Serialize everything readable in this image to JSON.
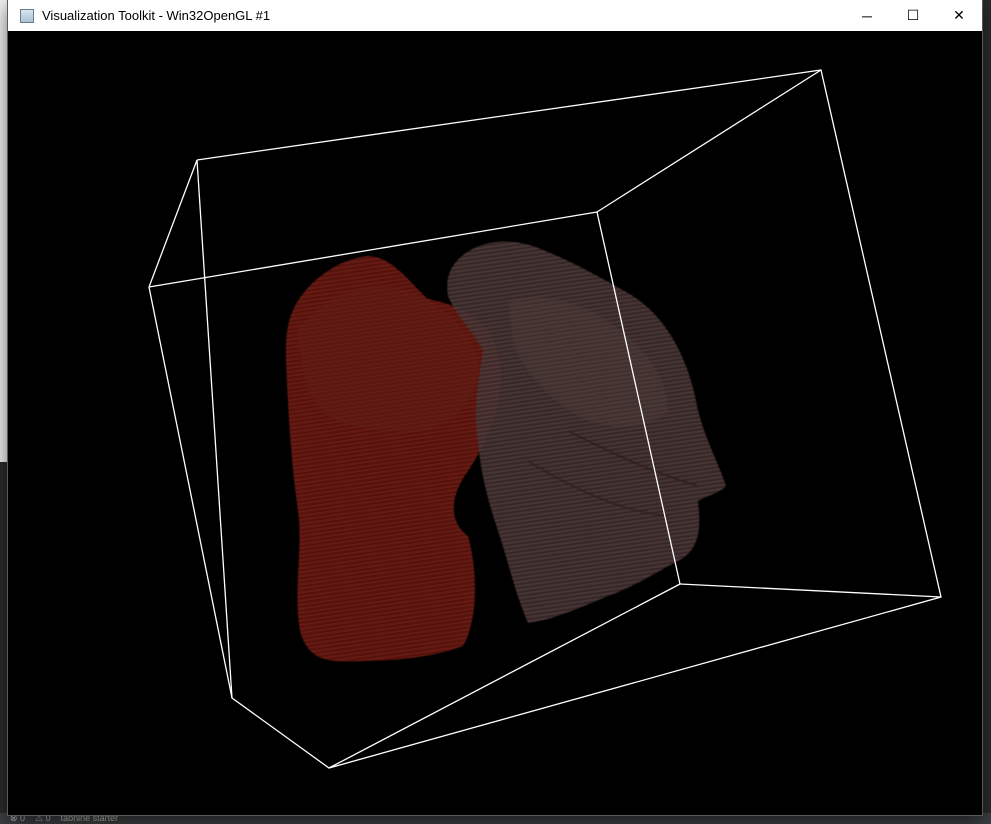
{
  "window": {
    "title": "Visualization Toolkit - Win32OpenGL #1",
    "minimize_glyph": "─",
    "maximize_glyph": "☐",
    "close_glyph": "✕",
    "icon": "vtk-window-icon"
  },
  "scene": {
    "background": "#000000",
    "outline_color": "#ffffff",
    "left_volume_color": "#6e1a14",
    "right_volume_color": "#4a3634"
  },
  "statusbar": {
    "errors": "⊗ 0",
    "warnings": "⚠ 0",
    "plugin": "tabnine starter"
  }
}
